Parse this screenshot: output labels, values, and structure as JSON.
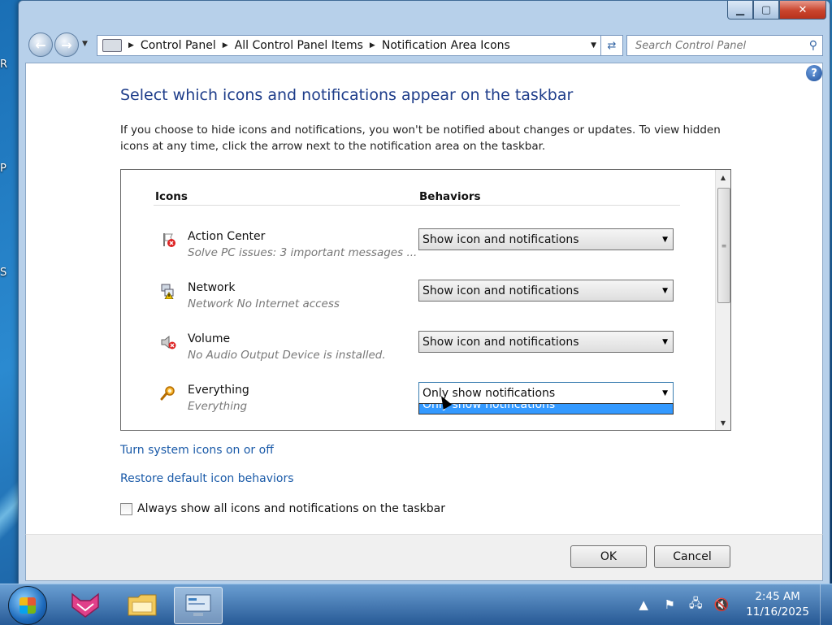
{
  "desktop": {
    "fragments": [
      "R",
      "P",
      "S"
    ]
  },
  "window": {
    "address": {
      "crumbs": [
        "Control Panel",
        "All Control Panel Items",
        "Notification Area Icons"
      ]
    },
    "search": {
      "placeholder": "Search Control Panel"
    }
  },
  "page": {
    "title": "Select which icons and notifications appear on the taskbar",
    "description": "If you choose to hide icons and notifications, you won't be notified about changes or updates. To view hidden icons at any time, click the arrow next to the notification area on the taskbar.",
    "columns": {
      "icons": "Icons",
      "behaviors": "Behaviors"
    },
    "rows": [
      {
        "name": "Action Center",
        "sub": "Solve PC issues: 3 important messages ...",
        "behavior": "Show icon and notifications",
        "icon": "action-center-flag-icon"
      },
      {
        "name": "Network",
        "sub": "Network No Internet access",
        "behavior": "Show icon and notifications",
        "icon": "network-icon"
      },
      {
        "name": "Volume",
        "sub": "No Audio Output Device is installed.",
        "behavior": "Show icon and notifications",
        "icon": "volume-muted-icon"
      },
      {
        "name": "Everything",
        "sub": "Everything",
        "behavior": "Only show notifications",
        "icon": "everything-search-icon"
      }
    ],
    "dropdown_highlight": "Only show notifications",
    "links": {
      "system_icons": "Turn system icons on or off",
      "restore": "Restore default icon behaviors"
    },
    "always_show_label": "Always show all icons and notifications on the taskbar",
    "ok": "OK",
    "cancel": "Cancel"
  },
  "taskbar": {
    "time": "2:45 AM",
    "date": "11/16/2025"
  }
}
